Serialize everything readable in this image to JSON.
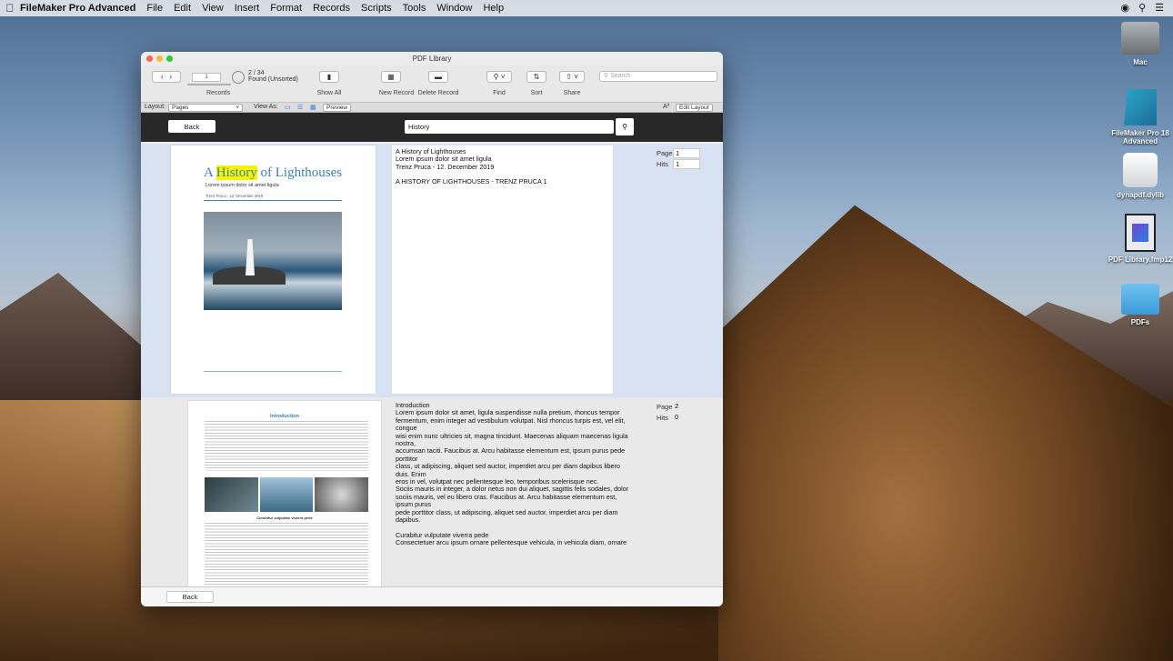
{
  "menubar": {
    "app_name": "FileMaker Pro Advanced",
    "items": [
      "File",
      "Edit",
      "View",
      "Insert",
      "Format",
      "Records",
      "Scripts",
      "Tools",
      "Window",
      "Help"
    ]
  },
  "desktop": {
    "icons": [
      {
        "label": "Mac",
        "icon": "hard-drive-icon"
      },
      {
        "label": "FileMaker Pro 18 Advanced",
        "icon": "filemaker-app-icon"
      },
      {
        "label": "dynapdf.dylib",
        "icon": "dylib-file-icon"
      },
      {
        "label": "PDF Library.fmp12",
        "icon": "fmp12-file-icon"
      },
      {
        "label": "PDFs",
        "icon": "folder-icon"
      }
    ]
  },
  "window": {
    "title": "PDF Library",
    "toolbar": {
      "record_number": "1",
      "record_count": "2 / 34",
      "found_status": "Found (Unsorted)",
      "records_label": "Records",
      "show_all_label": "Show All",
      "new_record_label": "New Record",
      "delete_record_label": "Delete Record",
      "find_label": "Find",
      "sort_label": "Sort",
      "share_label": "Share",
      "search_placeholder": "Search"
    },
    "layout_bar": {
      "layout_label": "Layout:",
      "layout_value": "Pages",
      "view_as_label": "View As:",
      "preview_label": "Preview",
      "edit_layout_label": "Edit Layout",
      "font_size_label": "Aª"
    },
    "header": {
      "back_label": "Back",
      "search_value": "History"
    },
    "records": [
      {
        "doc_title_pre": "A ",
        "doc_title_hl": "History",
        "doc_title_post": " of Lighthouses",
        "doc_subtitle": "Lorem ipsum dolor sit amet ligula",
        "doc_meta": "Trenz Pruca - 12. December 2019",
        "text_lines": [
          "A History of Lighthouses",
          "Lorem ipsum dolor sit amet ligula",
          "Trenz Pruca - 12. December 2019",
          "",
          "A HISTORY OF LIGHTHOUSES - TRENZ PRUCA 1"
        ],
        "page_label": "Page",
        "page_value": "1",
        "hits_label": "Hits",
        "hits_value": "1"
      },
      {
        "doc_heading": "Introduction",
        "doc_caption": "Curabitur vulputate viverra pede",
        "text_lines": [
          "Introduction",
          "Lorem ipsum dolor sit amet, ligula suspendisse nulla pretium, rhoncus tempor",
          "fermentum, enim integer ad vestibulum volutpat. Nisl rhoncus turpis est, vel elit, congue",
          "wisi enim nunc ultricies sit, magna tincidunt. Maecenas aliquam maecenas ligula nostra,",
          "accumsan taciti. Faucibus at. Arcu habitasse elementum est, ipsum purus pede porttitor",
          "class, ut adipiscing, aliquet sed auctor, imperdiet arcu per diam dapibus libero duis. Enim",
          "eros in vel, volutpat nec pellentesque leo, temporibus scelerisque nec.",
          "Sociis mauris in integer, a dolor netus non dui aliquet, sagittis felis sodales, dolor",
          "sociis mauris, vel eu libero cras. Faucibus at. Arcu habitasse elementum est, ipsum purus",
          "pede porttitor class, ut adipiscing, aliquet sed auctor, imperdiet arcu per diam dapibus.",
          "",
          "Curabitur vulputate viverra pede",
          "Consectetuer arcu ipsum ornare pellentesque vehicula, in vehicula diam, ornare"
        ],
        "page_label": "Page",
        "page_value": "2",
        "hits_label": "Hits",
        "hits_value": "0"
      }
    ],
    "footer": {
      "back_label": "Back"
    }
  },
  "colors": {
    "accent": "#3e7fb8",
    "highlight": "#f5f500",
    "header_bg": "#282828",
    "selected_row_bg": "#d9e2f3"
  }
}
